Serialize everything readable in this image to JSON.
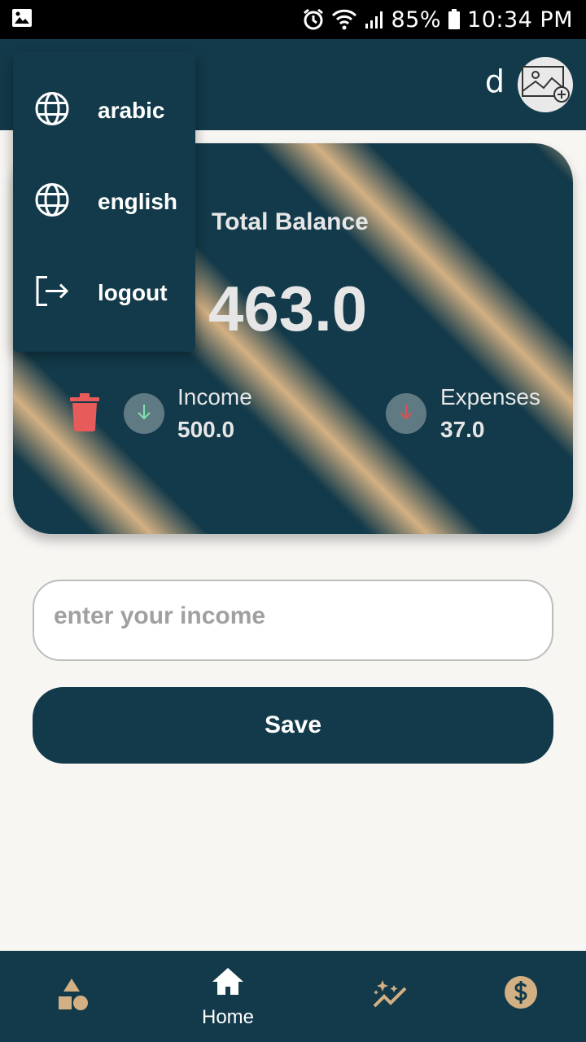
{
  "status_bar": {
    "battery": "85%",
    "time": "10:34 PM",
    "icons": [
      "image-icon",
      "alarm-icon",
      "wifi-icon",
      "signal-icon",
      "battery-icon"
    ]
  },
  "header": {
    "user_initial": "d",
    "avatar_icon": "add-photo-icon"
  },
  "menu": {
    "items": [
      {
        "label": "arabic",
        "icon": "globe-icon"
      },
      {
        "label": "english",
        "icon": "globe-icon"
      },
      {
        "label": "logout",
        "icon": "logout-icon"
      }
    ]
  },
  "balance_card": {
    "title": "Total Balance",
    "amount": "463.0",
    "income_label": "Income",
    "income_value": "500.0",
    "expenses_label": "Expenses",
    "expenses_value": "37.0",
    "colors": {
      "primary": "#133a4a",
      "accent": "#d3b083",
      "income": "#7fe3b0",
      "expense": "#d9534f",
      "trash": "#e85b5b"
    }
  },
  "form": {
    "income_placeholder": "enter your income",
    "income_value": "",
    "save_label": "Save"
  },
  "bottom_nav": {
    "items": [
      {
        "label": "",
        "icon": "shapes-icon"
      },
      {
        "label": "Home",
        "icon": "home-icon"
      },
      {
        "label": "",
        "icon": "insights-icon"
      },
      {
        "label": "",
        "icon": "dollar-icon"
      }
    ],
    "active_index": 1
  }
}
